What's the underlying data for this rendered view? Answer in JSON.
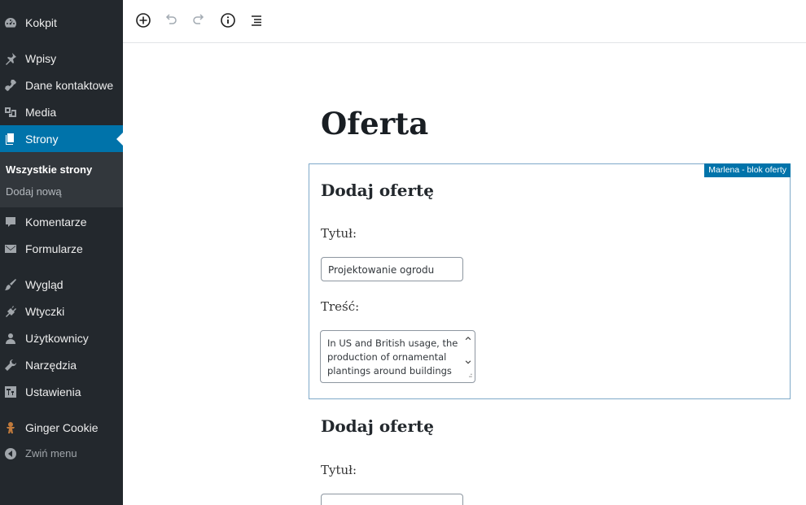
{
  "sidebar": {
    "items": [
      {
        "label": "Kokpit",
        "icon": "dashboard-icon"
      },
      {
        "label": "Wpisy",
        "icon": "pin-icon"
      },
      {
        "label": "Dane kontaktowe",
        "icon": "phone-icon"
      },
      {
        "label": "Media",
        "icon": "media-icon"
      },
      {
        "label": "Strony",
        "icon": "pages-icon"
      },
      {
        "label": "Komentarze",
        "icon": "comment-icon"
      },
      {
        "label": "Formularze",
        "icon": "mail-icon"
      },
      {
        "label": "Wygląd",
        "icon": "brush-icon"
      },
      {
        "label": "Wtyczki",
        "icon": "plugin-icon"
      },
      {
        "label": "Użytkownicy",
        "icon": "users-icon"
      },
      {
        "label": "Narzędzia",
        "icon": "wrench-icon"
      },
      {
        "label": "Ustawienia",
        "icon": "settings-icon"
      },
      {
        "label": "Ginger Cookie",
        "icon": "cookie-icon"
      }
    ],
    "submenu": [
      {
        "label": "Wszystkie strony"
      },
      {
        "label": "Dodaj nową"
      }
    ],
    "collapse_label": "Zwiń menu",
    "active_color": "#0073aa"
  },
  "toolbar": {
    "buttons": [
      "add-block-icon",
      "undo-icon",
      "redo-icon",
      "info-icon",
      "outline-icon"
    ]
  },
  "editor": {
    "title": "Oferta",
    "block": {
      "tag": "Marlena - blok oferty",
      "heading": "Dodaj ofertę",
      "title_label": "Tytuł:",
      "title_value": "Projektowanie ogrodu",
      "content_label": "Treść:",
      "content_value": "In US and British usage, the production of ornamental plantings around buildings"
    },
    "block2": {
      "heading": "Dodaj ofertę",
      "title_label": "Tytuł:"
    }
  }
}
